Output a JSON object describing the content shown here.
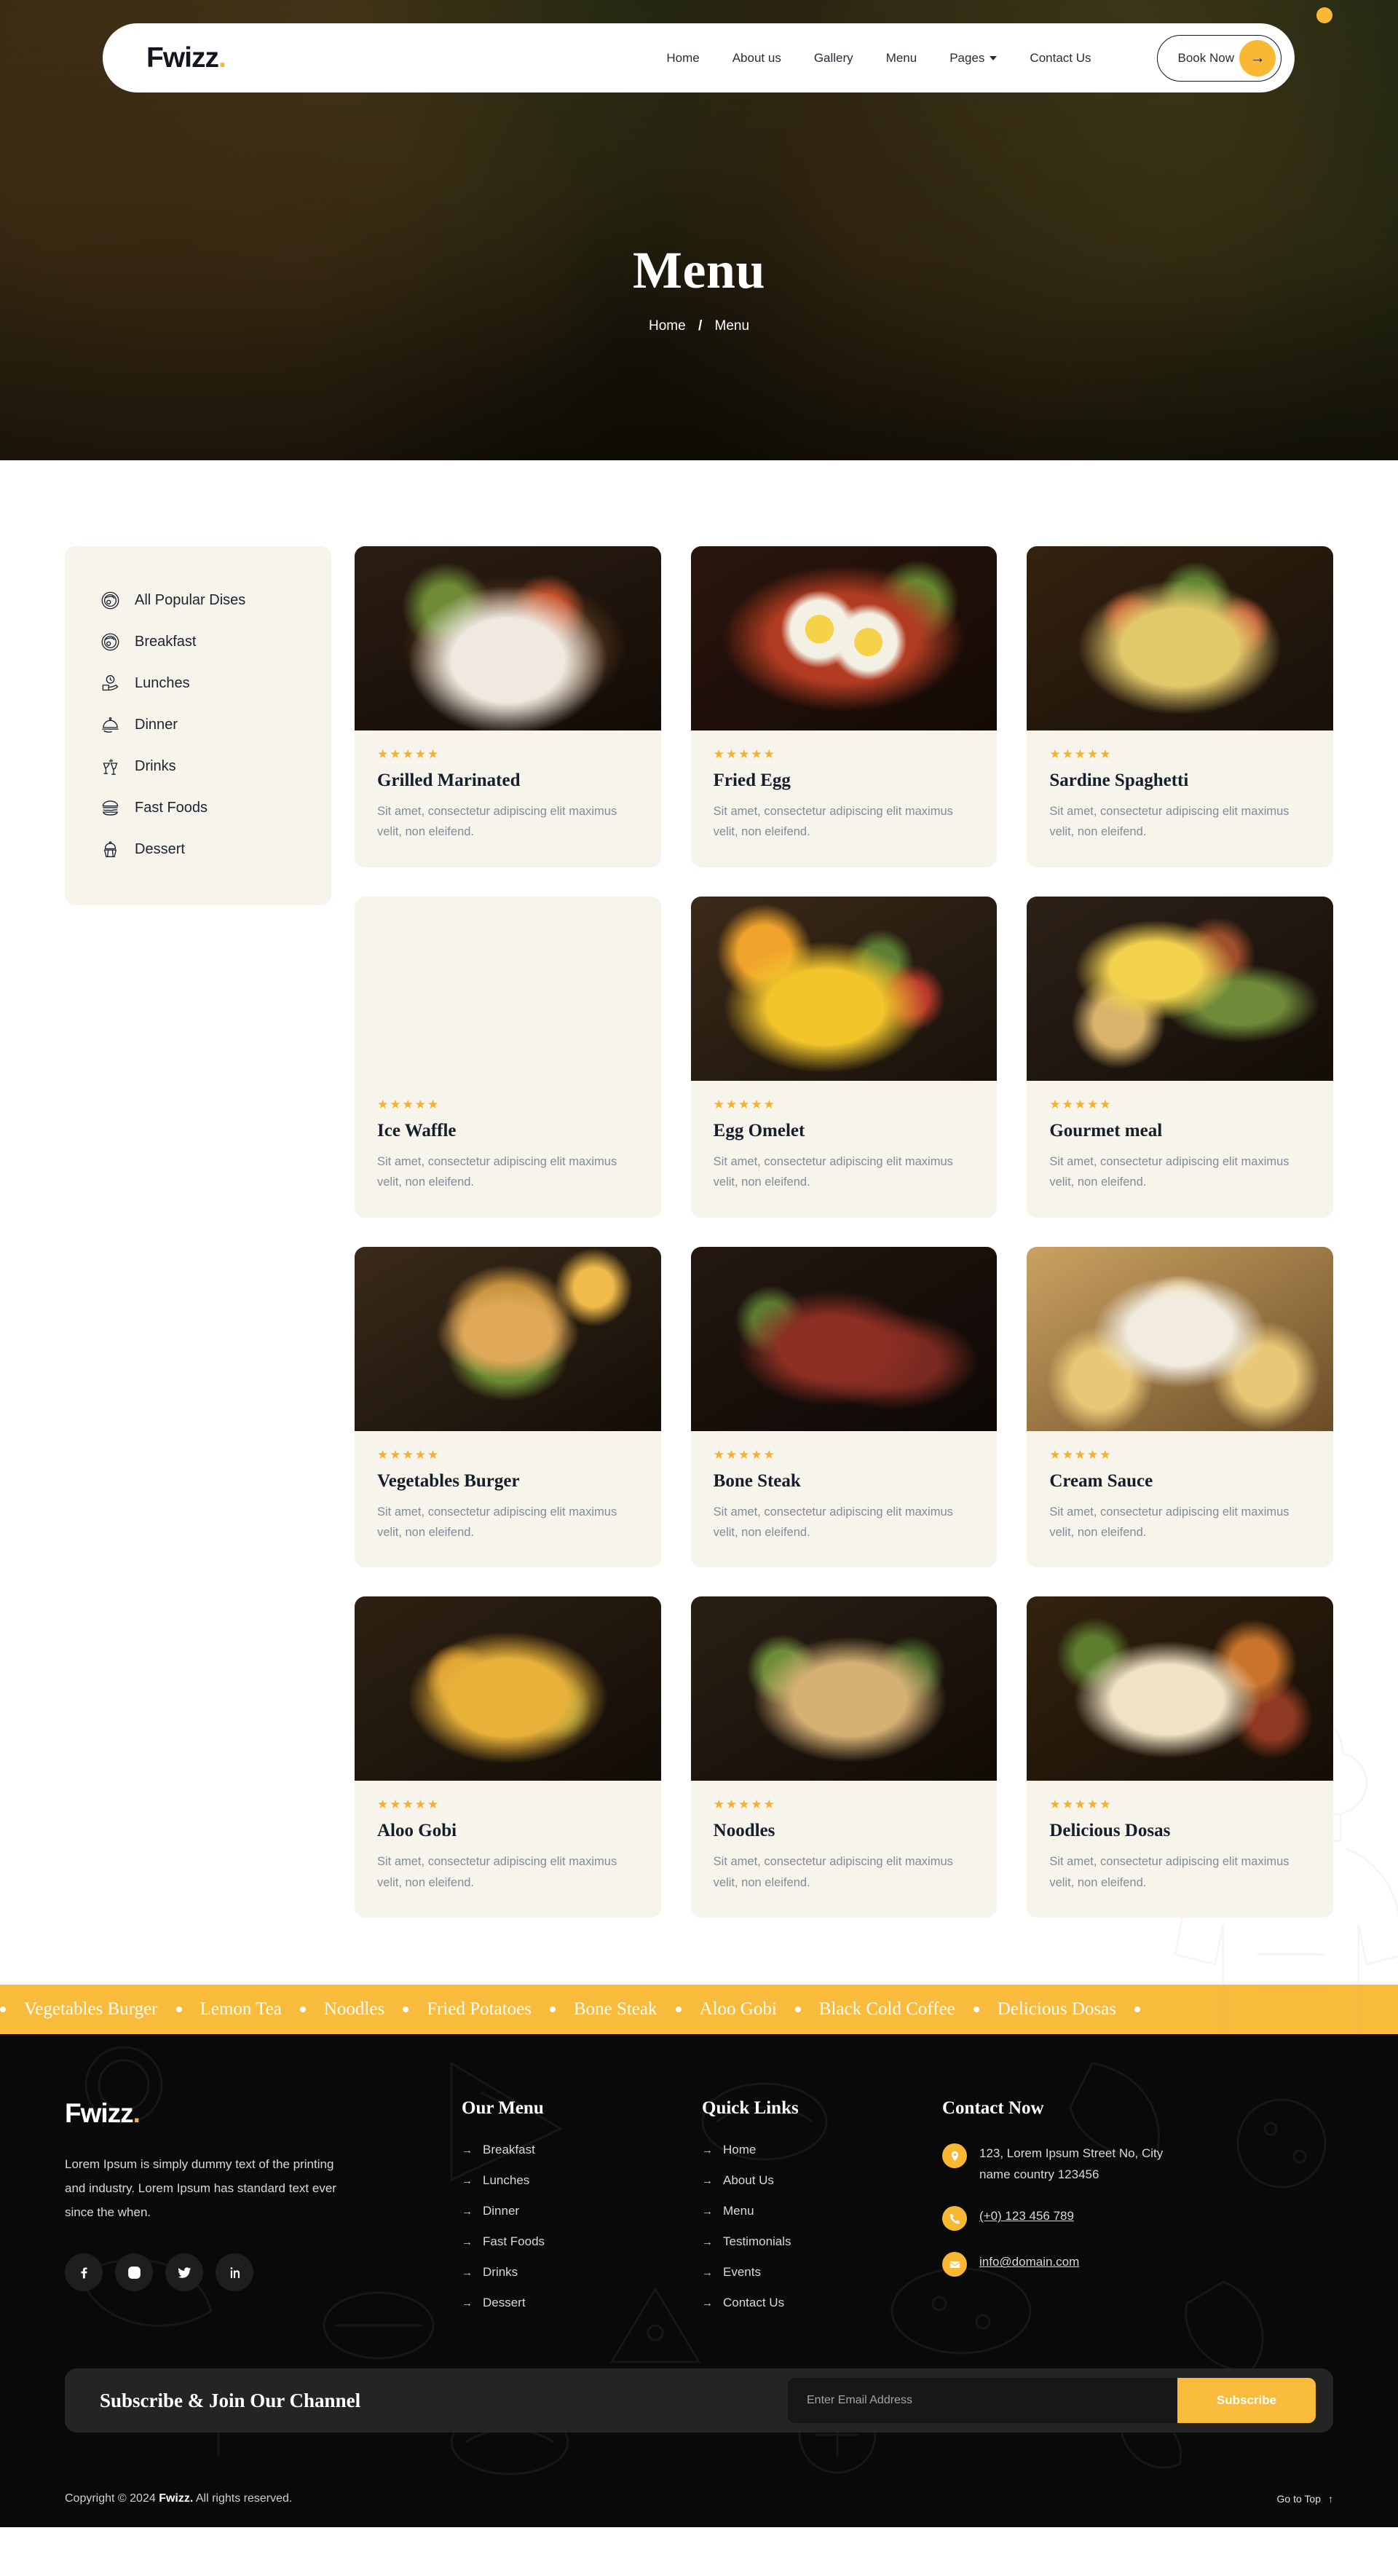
{
  "header": {
    "logo": "Fwizz",
    "logo_dot": ".",
    "nav": [
      {
        "label": "Home",
        "has_caret": false
      },
      {
        "label": "About us",
        "has_caret": false
      },
      {
        "label": "Gallery",
        "has_caret": false
      },
      {
        "label": "Menu",
        "has_caret": false
      },
      {
        "label": "Pages",
        "has_caret": true
      },
      {
        "label": "Contact Us",
        "has_caret": false
      }
    ],
    "cta_label": "Book Now",
    "cta_arrow": "→"
  },
  "hero": {
    "title": "Menu",
    "breadcrumb_home": "Home",
    "breadcrumb_sep": "/",
    "breadcrumb_current": "Menu"
  },
  "sidebar": {
    "categories": [
      {
        "label": "All Popular Dises",
        "icon": "plate-icon"
      },
      {
        "label": "Breakfast",
        "icon": "plate-icon"
      },
      {
        "label": "Lunches",
        "icon": "lunchbox-icon"
      },
      {
        "label": "Dinner",
        "icon": "cloche-icon"
      },
      {
        "label": "Drinks",
        "icon": "cheers-glasses-icon"
      },
      {
        "label": "Fast Foods",
        "icon": "burger-icon"
      },
      {
        "label": "Dessert",
        "icon": "cupcake-icon"
      }
    ]
  },
  "menu": {
    "rating_stars": "★★★★★",
    "description": "Sit amet, consectetur adipiscing elit maximus velit, non eleifend.",
    "items": [
      {
        "title": "Grilled Marinated",
        "image": "grilled-marinated-photo"
      },
      {
        "title": "Fried Egg",
        "image": "fried-egg-photo"
      },
      {
        "title": "Sardine Spaghetti",
        "image": "sardine-spaghetti-photo"
      },
      {
        "title": "Ice Waffle",
        "image": "ice-waffle-photo"
      },
      {
        "title": "Egg Omelet",
        "image": "egg-omelet-photo"
      },
      {
        "title": "Gourmet meal",
        "image": "gourmet-meal-photo"
      },
      {
        "title": "Vegetables Burger",
        "image": "vegetables-burger-photo"
      },
      {
        "title": "Bone Steak",
        "image": "bone-steak-photo"
      },
      {
        "title": "Cream Sauce",
        "image": "cream-sauce-photo"
      },
      {
        "title": "Aloo Gobi",
        "image": "aloo-gobi-photo"
      },
      {
        "title": "Noodles",
        "image": "noodles-photo"
      },
      {
        "title": "Delicious Dosas",
        "image": "delicious-dosas-photo"
      }
    ]
  },
  "ticker": {
    "items": [
      "Vegetables Burger",
      "Lemon Tea",
      "Noodles",
      "Fried Potatoes",
      "Bone Steak",
      "Aloo Gobi",
      "Black Cold Coffee",
      "Delicious Dosas"
    ]
  },
  "footer": {
    "logo": "Fwizz",
    "logo_dot": ".",
    "about": "Lorem Ipsum is simply dummy text of the printing and industry. Lorem Ipsum has standard text ever since the when.",
    "socials": [
      {
        "name": "facebook-icon"
      },
      {
        "name": "instagram-icon"
      },
      {
        "name": "twitter-icon"
      },
      {
        "name": "linkedin-icon"
      }
    ],
    "our_menu": {
      "heading": "Our Menu",
      "links": [
        "Breakfast",
        "Lunches",
        "Dinner",
        "Fast Foods",
        "Drinks",
        "Dessert"
      ]
    },
    "quick_links": {
      "heading": "Quick Links",
      "links": [
        "Home",
        "About Us",
        "Menu",
        "Testimonials",
        "Events",
        "Contact Us"
      ]
    },
    "contact": {
      "heading": "Contact Now",
      "address": "123, Lorem Ipsum Street No, City name country 123456",
      "phone": "(+0) 123 456 789",
      "email": "info@domain.com"
    },
    "subscribe": {
      "title": "Subscribe & Join Our Channel",
      "placeholder": "Enter Email Address",
      "value": "",
      "button": "Subscribe"
    },
    "copyright_pre": "Copyright © 2024 ",
    "copyright_brand": "Fwizz.",
    "copyright_post": " All rights reserved.",
    "go_to_top": "Go to Top",
    "go_to_top_arrow": "↑"
  },
  "colors": {
    "accent": "#f9bb3c",
    "accent_dark": "#f5b02e",
    "card_bg": "#f7f4ec",
    "footer_bg": "#090909",
    "text_dark": "#1b2230"
  },
  "arrow_bullet": "→"
}
